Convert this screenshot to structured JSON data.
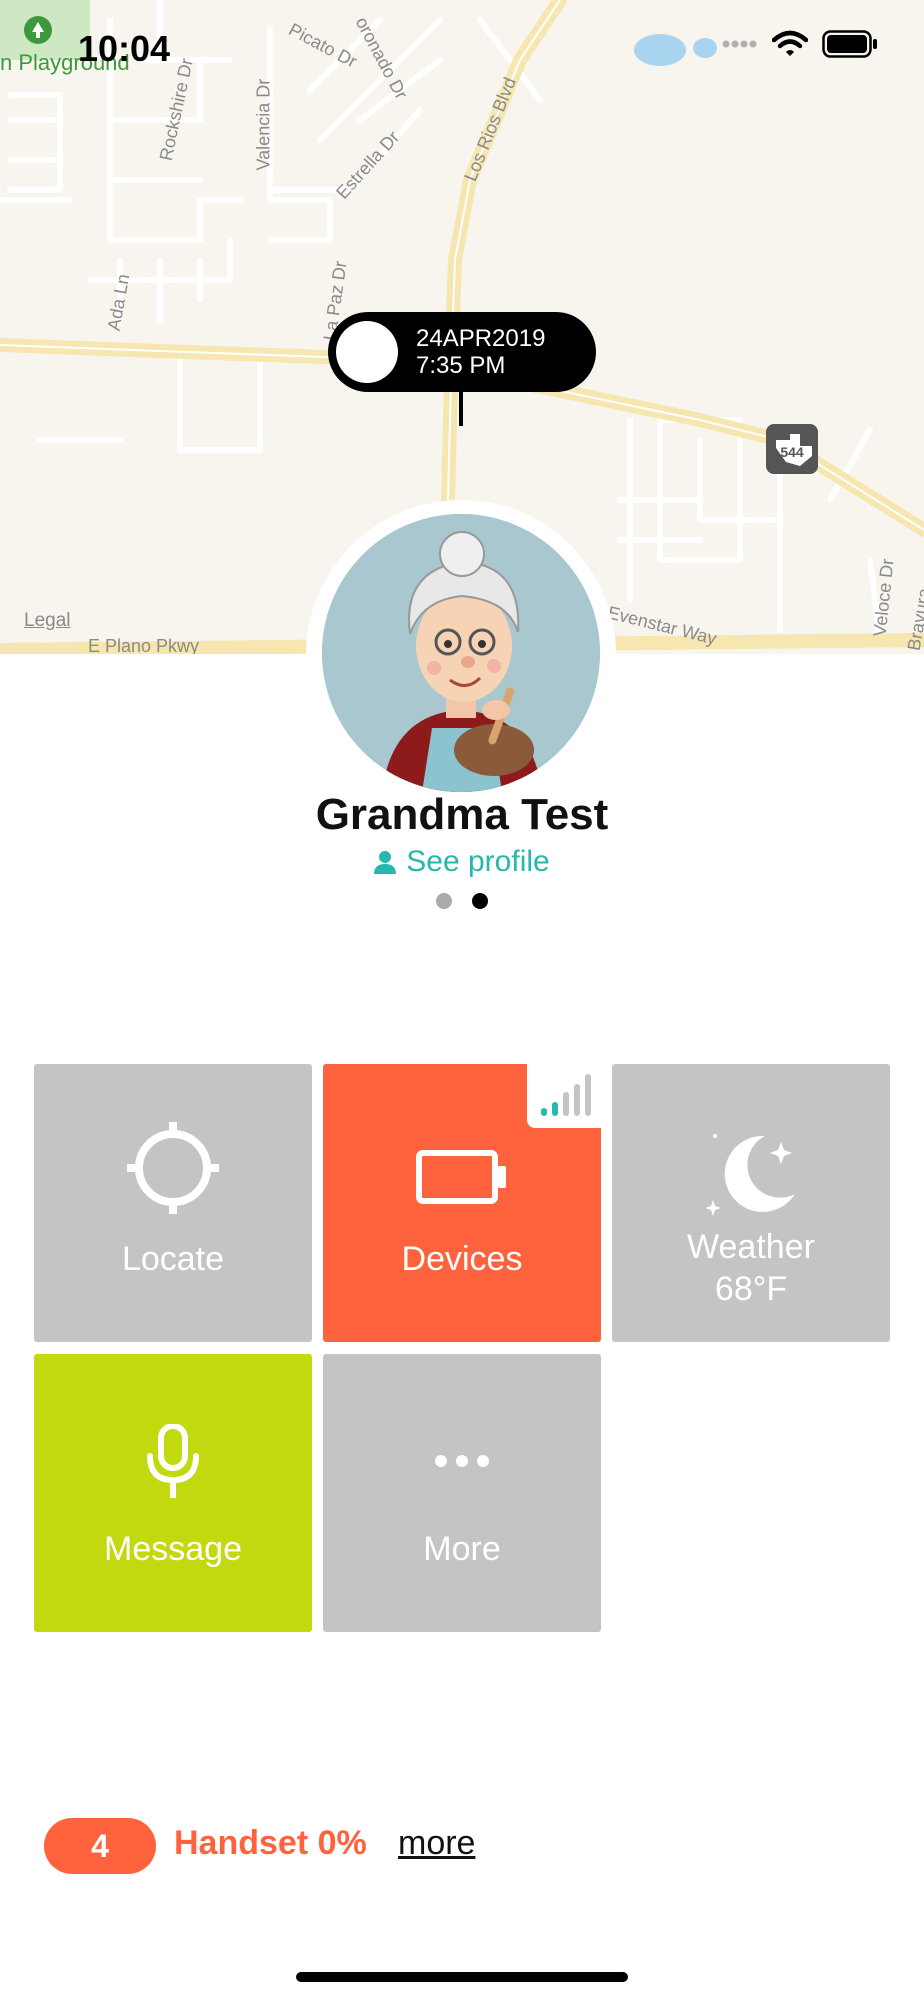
{
  "status_bar": {
    "time": "10:04"
  },
  "map": {
    "park_label": "n Playground",
    "legal_label": "Legal",
    "streets": {
      "picato": "Picato Dr",
      "coronado": "oronado Dr",
      "rockshire": "Rockshire Dr",
      "valencia": "Valencia Dr",
      "estrella": "Estrella Dr",
      "los_rios": "Los Rios Blvd",
      "ada": "Ada Ln",
      "la_paz": "La Paz Dr",
      "evenstar": "Evenstar Way",
      "veloce": "Veloce Dr",
      "bravura": "Bravura",
      "plano": "E Plano Pkwy"
    },
    "highway_shield": "544",
    "pin": {
      "date": "24APR2019",
      "time": "7:35 PM"
    }
  },
  "profile": {
    "name": "Grandma Test",
    "see_profile_label": "See profile",
    "page_count": 2,
    "active_page": 2
  },
  "tiles": {
    "locate": "Locate",
    "devices": "Devices",
    "weather_title": "Weather",
    "weather_temp": "68°F",
    "message": "Message",
    "more": "More"
  },
  "footer": {
    "badge_count": "4",
    "handset_status": "Handset 0%",
    "more_link": "more"
  },
  "colors": {
    "accent_teal": "#27b7ad",
    "alert_orange": "#ff633e",
    "message_green": "#c2d90f",
    "tile_grey": "#c4c4c4"
  },
  "icons": [
    "wifi-icon",
    "battery-status-icon",
    "crosshair-icon",
    "battery-icon",
    "signal-bars-icon",
    "moon-stars-icon",
    "microphone-icon",
    "ellipsis-icon",
    "person-icon",
    "highway-shield-icon",
    "park-pin-icon"
  ]
}
